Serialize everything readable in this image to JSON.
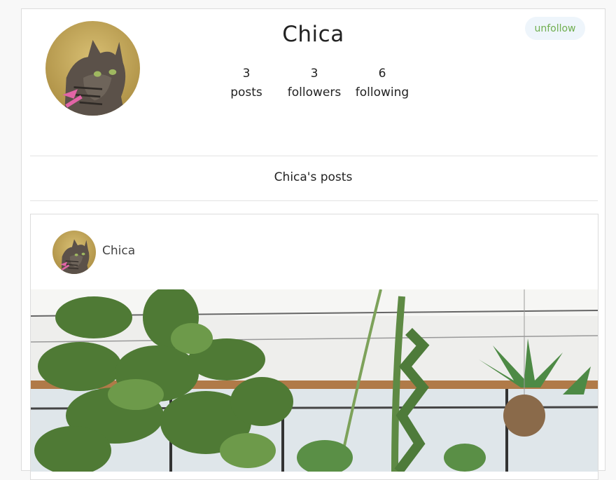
{
  "profile": {
    "name": "Chica",
    "avatar_icon": "cat-avatar",
    "unfollow_label": "unfollow",
    "stats": {
      "posts": {
        "count": "3",
        "label": "posts"
      },
      "followers": {
        "count": "3",
        "label": "followers"
      },
      "following": {
        "count": "6",
        "label": "following"
      }
    }
  },
  "posts_section": {
    "heading": "Chica's posts"
  },
  "post": {
    "author": "Chica",
    "image_subject": "houseplants"
  },
  "colors": {
    "unfollow_text": "#6fae4f",
    "unfollow_bg": "#eef5fb"
  }
}
